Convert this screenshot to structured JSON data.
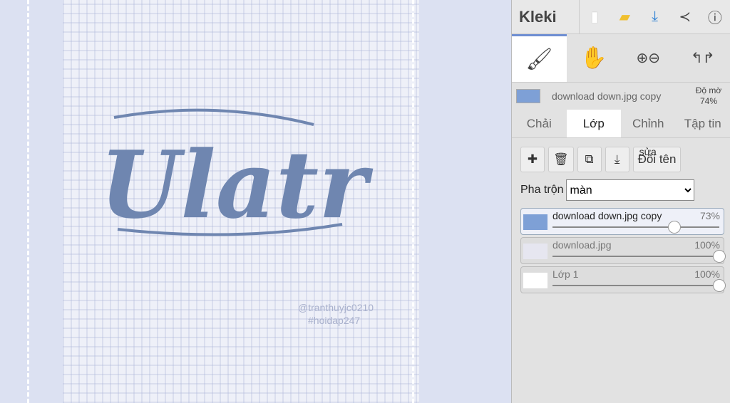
{
  "canvas": {
    "title_art": "Ulatr",
    "watermark_line1": "@tranthuyjc0210",
    "watermark_line2": "#hoidap247",
    "art_color": "#6f86b0"
  },
  "topbar": {
    "logo": "Kleki",
    "icons": [
      "new-file-icon",
      "open-folder-icon",
      "download-icon",
      "share-icon",
      "help-icon"
    ]
  },
  "tools": [
    "brush-icon",
    "hand-icon",
    "zoom-icon",
    "undo-redo-icon"
  ],
  "current_layer": {
    "name": "download down.jpg copy",
    "opacity_label": "Độ mờ",
    "opacity": "74%"
  },
  "tabs": [
    "Chải",
    "Lớp",
    "Chỉnh",
    "Tập tin"
  ],
  "layer_buttons": {
    "rename": "Đổi tên",
    "rename_overlay": "sửa"
  },
  "blend": {
    "label": "Pha trộn",
    "value": "màn"
  },
  "layers": [
    {
      "name": "download down.jpg copy",
      "opacity": "73%",
      "value": 0.73,
      "active": true
    },
    {
      "name": "download.jpg",
      "opacity": "100%",
      "value": 1.0
    },
    {
      "name": "Lớp 1",
      "opacity": "100%",
      "value": 1.0
    }
  ]
}
